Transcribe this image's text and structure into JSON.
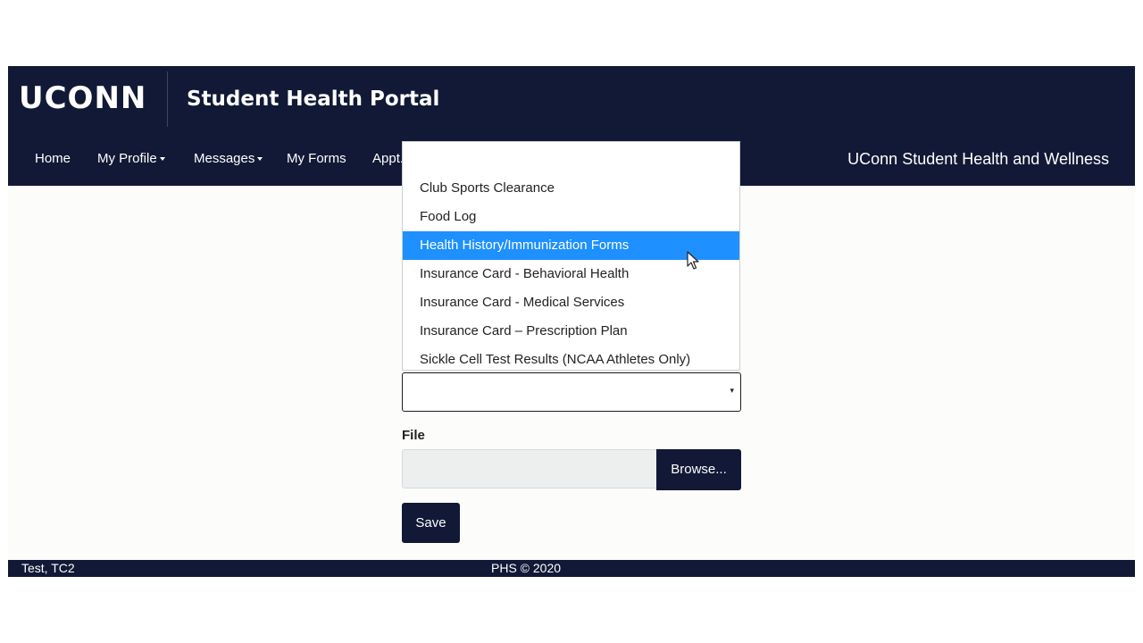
{
  "header": {
    "logo_text": "UCONN",
    "portal_title": "Student Health Portal",
    "brand_right": "UConn Student Health and Wellness"
  },
  "nav": {
    "items": [
      {
        "label": "Home",
        "has_caret": false
      },
      {
        "label": "My Profile",
        "has_caret": true
      },
      {
        "label": "Messages",
        "has_caret": true
      },
      {
        "label": "My Forms",
        "has_caret": false
      },
      {
        "label": "Appt.",
        "has_caret": false
      }
    ]
  },
  "dropdown": {
    "options": [
      "",
      "Club Sports Clearance",
      "Food Log",
      "Health History/Immunization Forms",
      "Insurance Card - Behavioral Health",
      "Insurance Card - Medical Services",
      "Insurance Card – Prescription Plan",
      "Sickle Cell Test Results (NCAA Athletes Only)"
    ],
    "highlighted": "Health History/Immunization Forms"
  },
  "form": {
    "select_value": "",
    "select_arrow": "▾",
    "file_label": "File",
    "file_value": "",
    "browse_label": "Browse...",
    "save_label": "Save"
  },
  "footer": {
    "user": "Test, TC2",
    "copyright": "PHS © 2020"
  },
  "colors": {
    "brand_navy": "#111936",
    "highlight_blue": "#1e90ff",
    "page_bg": "#fcfcfa"
  }
}
